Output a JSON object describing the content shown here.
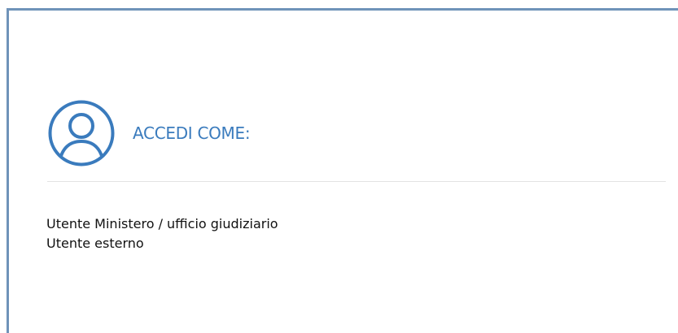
{
  "login": {
    "title": "ACCEDI COME:",
    "user_icon": "user-circle-icon",
    "options": [
      {
        "label": "Utente Ministero / ufficio giudiziario"
      },
      {
        "label": "Utente esterno"
      }
    ]
  },
  "colors": {
    "accent": "#3a7bbd",
    "frame_border": "#6f93b9",
    "divider": "#e3e3e3",
    "text": "#111111"
  }
}
